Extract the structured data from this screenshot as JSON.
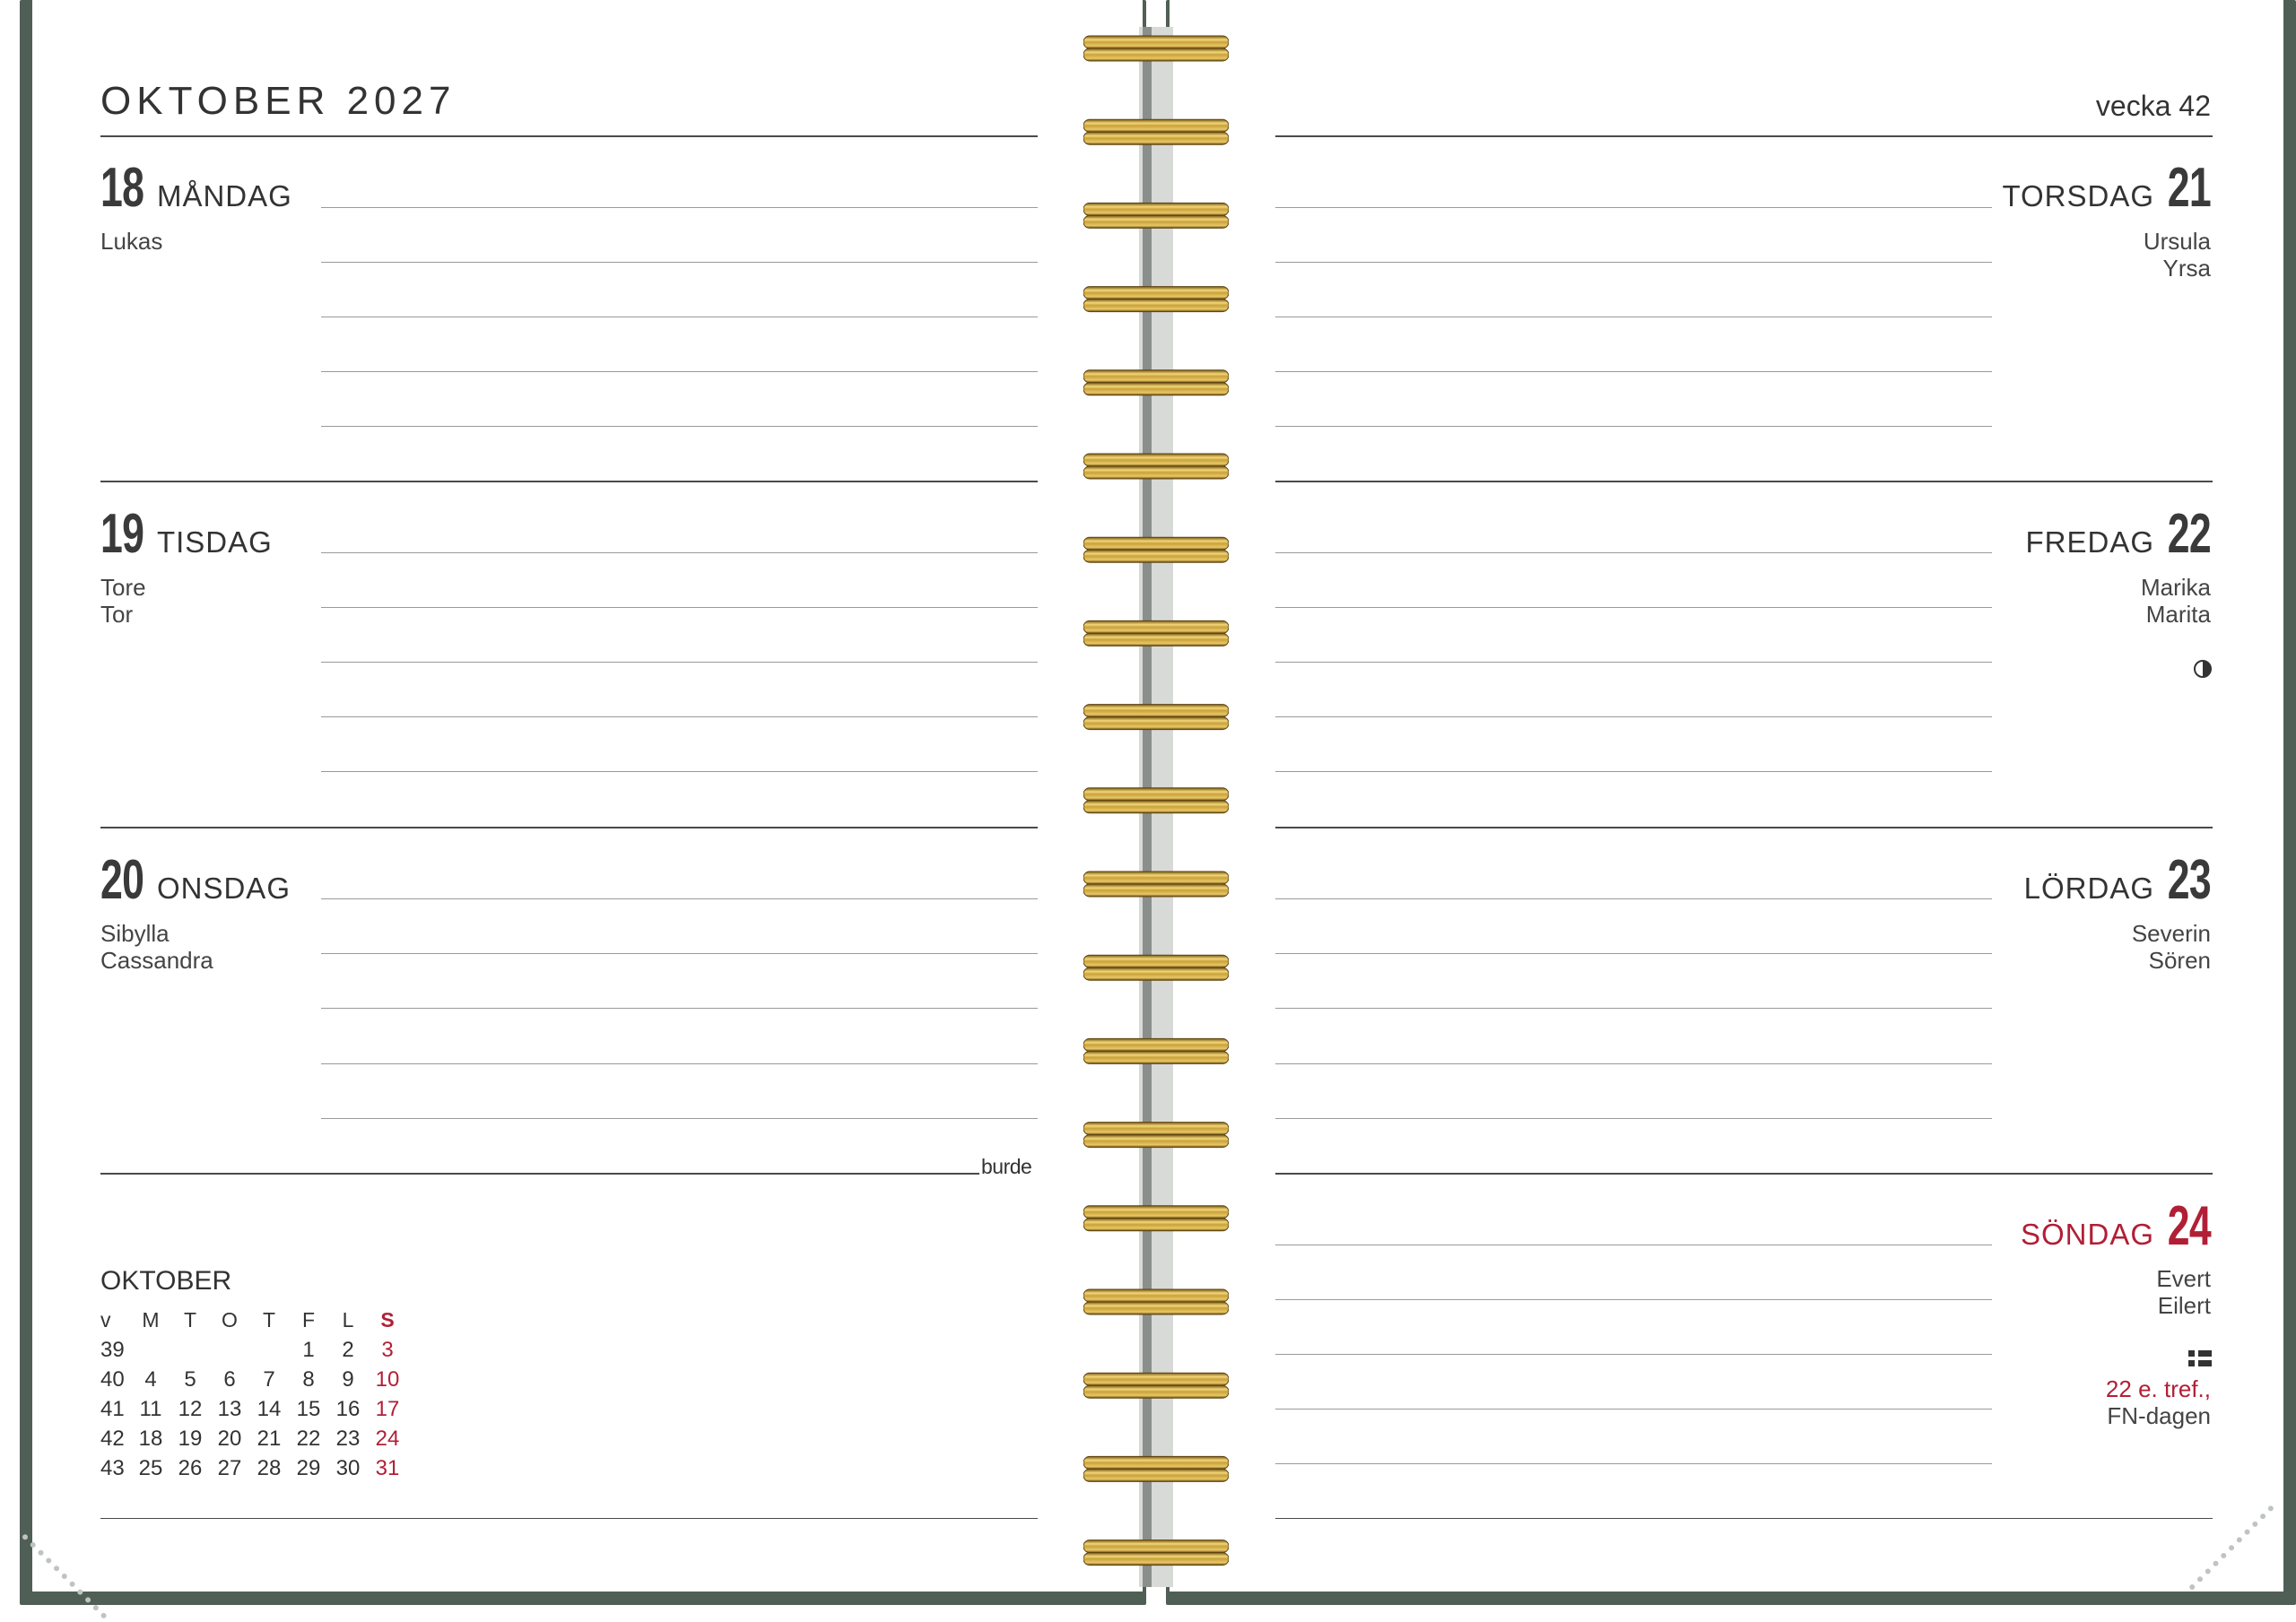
{
  "left_page": {
    "month_year": "OKTOBER 2027",
    "days": [
      {
        "num": "18",
        "name": "MÅNDAG",
        "namedays": [
          "Lukas"
        ]
      },
      {
        "num": "19",
        "name": "TISDAG",
        "namedays": [
          "Tore",
          "Tor"
        ]
      },
      {
        "num": "20",
        "name": "ONSDAG",
        "namedays": [
          "Sibylla",
          "Cassandra"
        ]
      }
    ],
    "brand": "burde",
    "mini_calendar": {
      "title": "OKTOBER",
      "headers": [
        "v",
        "M",
        "T",
        "O",
        "T",
        "F",
        "L",
        "S"
      ],
      "rows": [
        [
          "39",
          "",
          "",
          "",
          "",
          "1",
          "2",
          "3"
        ],
        [
          "40",
          "4",
          "5",
          "6",
          "7",
          "8",
          "9",
          "10"
        ],
        [
          "41",
          "11",
          "12",
          "13",
          "14",
          "15",
          "16",
          "17"
        ],
        [
          "42",
          "18",
          "19",
          "20",
          "21",
          "22",
          "23",
          "24"
        ],
        [
          "43",
          "25",
          "26",
          "27",
          "28",
          "29",
          "30",
          "31"
        ]
      ]
    }
  },
  "right_page": {
    "week_label": "vecka 42",
    "days": [
      {
        "num": "21",
        "name": "TORSDAG",
        "namedays": [
          "Ursula",
          "Yrsa"
        ]
      },
      {
        "num": "22",
        "name": "FREDAG",
        "namedays": [
          "Marika",
          "Marita"
        ],
        "icon": "half-moon-icon"
      },
      {
        "num": "23",
        "name": "LÖRDAG",
        "namedays": [
          "Severin",
          "Sören"
        ]
      },
      {
        "num": "24",
        "name": "SÖNDAG",
        "namedays": [
          "Evert",
          "Eilert"
        ],
        "icon": "swedish-flag-icon",
        "holiday": "22 e. tref.,",
        "event": "FN-dagen"
      }
    ]
  },
  "colors": {
    "accent_red": "#b11f36",
    "cover_green": "#4f5f55",
    "spiral_gold": "#c9a13a"
  }
}
